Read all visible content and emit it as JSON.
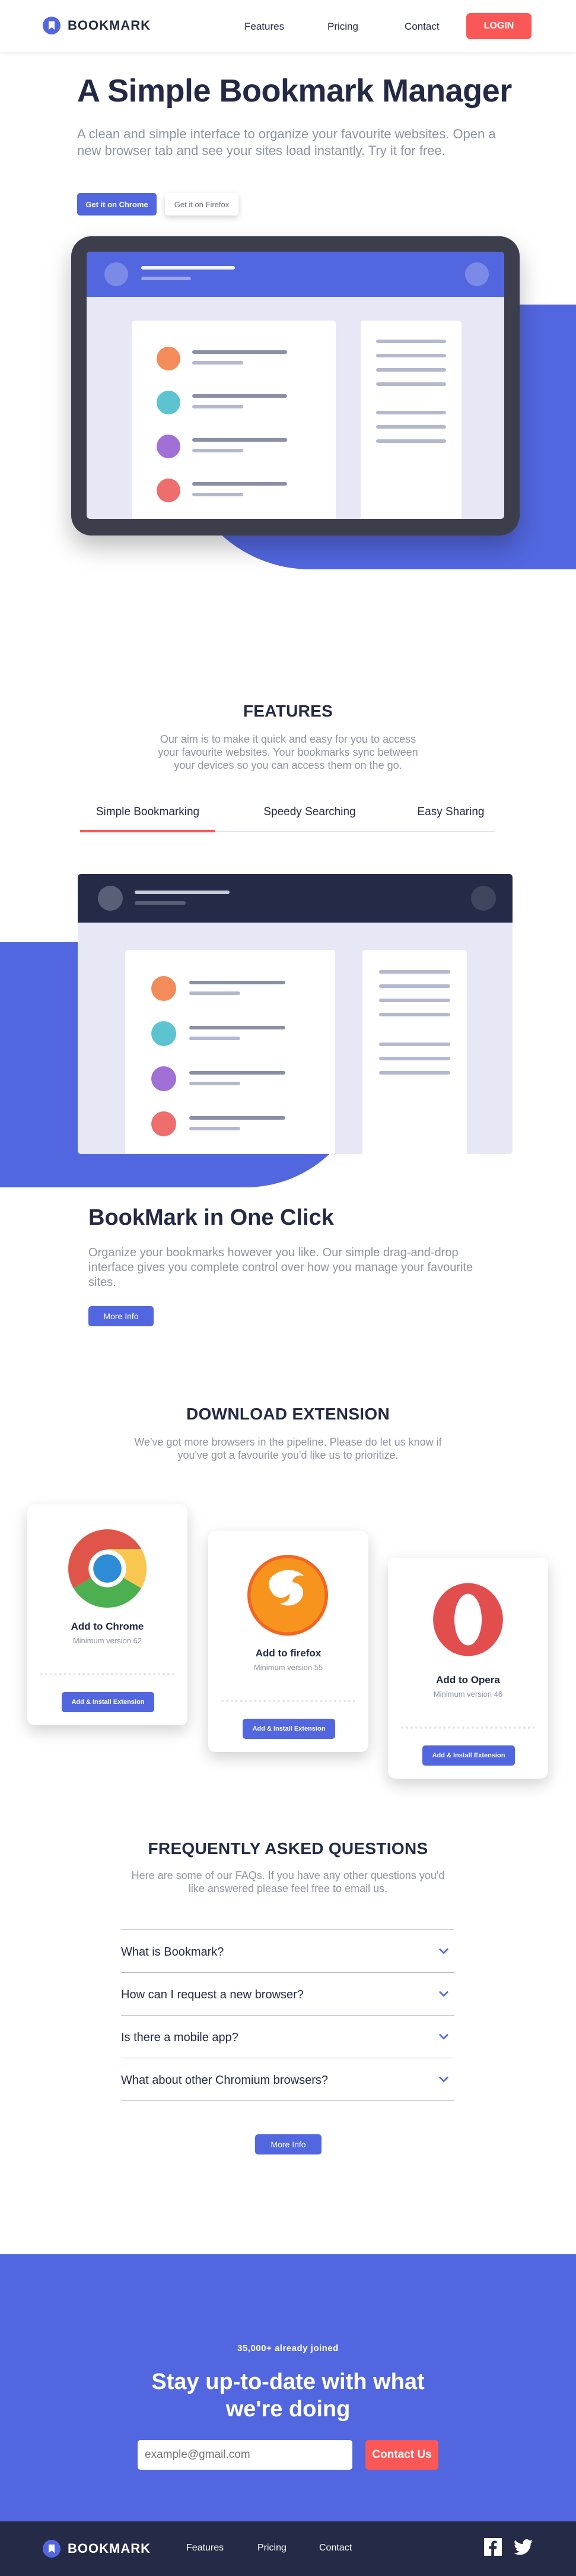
{
  "brand": {
    "name": "BOOKMARK",
    "accent": "#5267df",
    "red": "#fa5757",
    "dark": "#242a45"
  },
  "nav": {
    "features": "Features",
    "pricing": "Pricing",
    "contact": "Contact",
    "login": "LOGIN"
  },
  "hero": {
    "title": "A Simple Bookmark Manager",
    "subtitle": "A clean and simple interface to organize your favourite websites. Open a new browser tab and see your sites load instantly. Try it for free.",
    "chrome_btn": "Get it on Chrome",
    "firefox_btn": "Get it on Firefox"
  },
  "features": {
    "title": "FEATURES",
    "intro": "Our aim is to make it quick and easy for you to access your favourite websites. Your bookmarks sync between your devices so you can access them on the go.",
    "tabs": [
      "Simple Bookmarking",
      "Speedy Searching",
      "Easy Sharing"
    ],
    "active_tab": "Simple Bookmarking",
    "panel_title": "BookMark in One Click",
    "panel_text": "Organize your bookmarks however you like. Our simple drag-and-drop interface gives you complete control over how you manage your favourite sites.",
    "more_info": "More Info"
  },
  "download": {
    "title": "DOWNLOAD EXTENSION",
    "intro": "We've got more browsers in the pipeline. Please do let us know if you've got a favourite you'd like us to prioritize.",
    "cards": [
      {
        "name": "Add to Chrome",
        "version": "Minimum version 62",
        "button": "Add & Install Extension",
        "icon": "chrome-logo-icon"
      },
      {
        "name": "Add to firefox",
        "version": "Minimum version 55",
        "button": "Add & Install Extension",
        "icon": "firefox-logo-icon"
      },
      {
        "name": "Add to Opera",
        "version": "Minimum version 46",
        "button": "Add & Install Extension",
        "icon": "opera-logo-icon"
      }
    ]
  },
  "faq": {
    "title": "FREQUENTLY ASKED QUESTIONS",
    "intro": "Here are some of our FAQs. If you have any other questions you'd like answered please feel free to email us.",
    "questions": [
      "What is Bookmark?",
      "How can I request a new browser?",
      "Is there a mobile app?",
      "What about other Chromium browsers?"
    ],
    "more_info": "More Info"
  },
  "cta": {
    "joined": "35,000+ already joined",
    "title": "Stay up-to-date with what we're doing",
    "email_placeholder": "example@gmail.com",
    "button": "Contact Us"
  },
  "footer": {
    "brand": "BOOKMARK",
    "features": "Features",
    "pricing": "Pricing",
    "contact": "Contact",
    "social": [
      "facebook-icon",
      "twitter-icon"
    ]
  }
}
